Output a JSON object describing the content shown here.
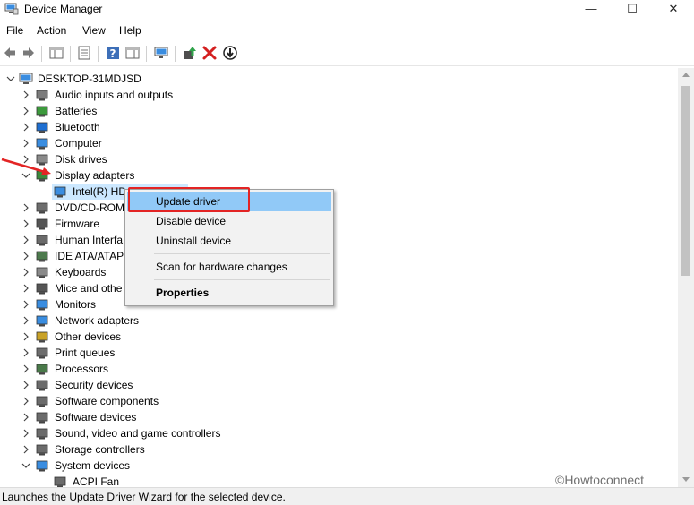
{
  "window": {
    "title": "Device Manager",
    "min_symbol": "—",
    "max_symbol": "☐",
    "close_symbol": "✕"
  },
  "menu": [
    "File",
    "Action",
    "View",
    "Help"
  ],
  "toolbar": {
    "icons": [
      "back-icon",
      "forward-icon",
      "show-hide-tree-icon",
      "properties-icon",
      "help-icon",
      "action-pane-icon",
      "scan-hardware-icon",
      "update-driver-icon",
      "uninstall-icon",
      "disable-icon"
    ]
  },
  "tree": {
    "root": "DESKTOP-31MDJSD",
    "items": [
      {
        "label": "Audio inputs and outputs",
        "icon": "speaker-icon",
        "expanded": false
      },
      {
        "label": "Batteries",
        "icon": "battery-icon",
        "expanded": false
      },
      {
        "label": "Bluetooth",
        "icon": "bluetooth-icon",
        "expanded": false
      },
      {
        "label": "Computer",
        "icon": "computer-icon",
        "expanded": false
      },
      {
        "label": "Disk drives",
        "icon": "disk-drive-icon",
        "expanded": false
      },
      {
        "label": "Display adapters",
        "icon": "display-adapter-icon",
        "expanded": true
      },
      {
        "label": "Intel(R) HD",
        "icon": "monitor-card-icon",
        "child": true,
        "selected": true
      },
      {
        "label": "DVD/CD-ROM",
        "icon": "dvd-icon",
        "expanded": false
      },
      {
        "label": "Firmware",
        "icon": "firmware-icon",
        "expanded": false
      },
      {
        "label": "Human Interfa",
        "icon": "hid-icon",
        "expanded": false
      },
      {
        "label": "IDE ATA/ATAPI",
        "icon": "ide-icon",
        "expanded": false
      },
      {
        "label": "Keyboards",
        "icon": "keyboard-icon",
        "expanded": false
      },
      {
        "label": "Mice and othe",
        "icon": "mouse-icon",
        "expanded": false
      },
      {
        "label": "Monitors",
        "icon": "monitor-icon",
        "expanded": false
      },
      {
        "label": "Network adapters",
        "icon": "network-adapter-icon",
        "expanded": false
      },
      {
        "label": "Other devices",
        "icon": "other-devices-icon",
        "expanded": false
      },
      {
        "label": "Print queues",
        "icon": "printer-icon",
        "expanded": false
      },
      {
        "label": "Processors",
        "icon": "processor-icon",
        "expanded": false
      },
      {
        "label": "Security devices",
        "icon": "security-device-icon",
        "expanded": false
      },
      {
        "label": "Software components",
        "icon": "software-component-icon",
        "expanded": false
      },
      {
        "label": "Software devices",
        "icon": "software-device-icon",
        "expanded": false
      },
      {
        "label": "Sound, video and game controllers",
        "icon": "sound-icon",
        "expanded": false
      },
      {
        "label": "Storage controllers",
        "icon": "storage-controller-icon",
        "expanded": false
      },
      {
        "label": "System devices",
        "icon": "system-devices-icon",
        "expanded": true
      },
      {
        "label": "ACPI Fan",
        "icon": "system-device-child-icon",
        "child": true
      }
    ]
  },
  "context_menu": {
    "items": [
      "Update driver",
      "Disable device",
      "Uninstall device",
      "Scan for hardware changes",
      "Properties"
    ],
    "highlighted": "Update driver"
  },
  "status_bar": {
    "text": "Launches the Update Driver Wizard for the selected device."
  },
  "watermark": "©Howtoconnect",
  "colors": {
    "selection": "#cce8ff",
    "menu_highlight": "#91c9f7",
    "annotation_red": "#e32424"
  }
}
